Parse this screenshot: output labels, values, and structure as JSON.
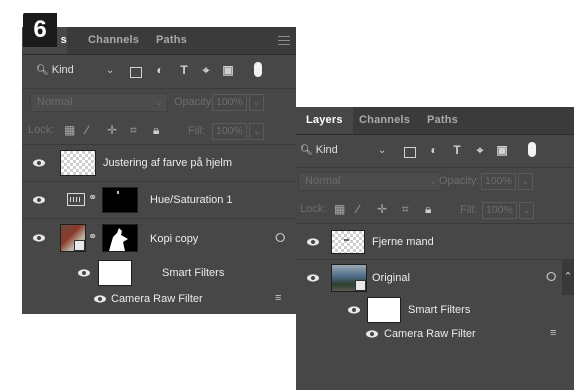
{
  "step_badge": "6",
  "panelA": {
    "tabs": [
      "s",
      "Channels",
      "Paths"
    ],
    "filter_kind": "Kind",
    "blend_mode": "Normal",
    "opacity_label": "Opacity:",
    "opacity_value": "100%",
    "lock_label": "Lock:",
    "fill_label": "Fill:",
    "fill_value": "100%",
    "layers": [
      {
        "name": "Justering af farve på hjelm"
      },
      {
        "name": "Hue/Saturation 1"
      },
      {
        "name": "Kopi copy"
      },
      {
        "name": "Smart Filters"
      },
      {
        "name": "Camera Raw Filter"
      }
    ]
  },
  "panelB": {
    "tabs": [
      "Layers",
      "Channels",
      "Paths"
    ],
    "filter_kind": "Kind",
    "blend_mode": "Normal",
    "opacity_label": "Opacity:",
    "opacity_value": "100%",
    "lock_label": "Lock:",
    "fill_label": "Fill:",
    "fill_value": "100%",
    "layers": [
      {
        "name": "Fjerne mand"
      },
      {
        "name": "Original"
      },
      {
        "name": "Smart Filters"
      },
      {
        "name": "Camera Raw Filter"
      }
    ]
  },
  "icons": {
    "eye": "eye-icon",
    "search": "search-icon",
    "chain": "link-icon",
    "smart": "smart-object-icon",
    "filter_settings": "filter-options-icon",
    "panel_menu": "panel-menu-icon"
  },
  "colors": {
    "panel_bg": "#474747",
    "tabbar_bg": "#3b3b3b",
    "badge_bg": "#1a1a1a"
  }
}
